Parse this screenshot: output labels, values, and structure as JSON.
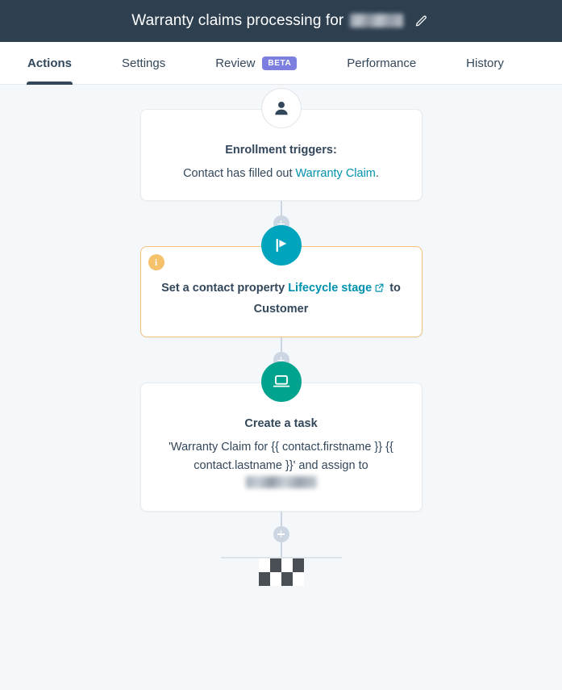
{
  "titlebar": {
    "title_prefix": "Warranty claims processing for",
    "redacted_company": "",
    "edit_icon": "pencil-icon"
  },
  "tabs": [
    {
      "label": "Actions",
      "active": true,
      "badge": null
    },
    {
      "label": "Settings",
      "active": false,
      "badge": null
    },
    {
      "label": "Review",
      "active": false,
      "badge": "BETA"
    },
    {
      "label": "Performance",
      "active": false,
      "badge": null
    },
    {
      "label": "History",
      "active": false,
      "badge": null
    }
  ],
  "flow": {
    "trigger": {
      "icon": "contact-person-icon",
      "title": "Enrollment triggers:",
      "text_before_link": "Contact has filled out ",
      "link": "Warranty Claim",
      "text_after_link": "."
    },
    "action_set_property": {
      "icon": "flag-icon",
      "badge_icon": "info-icon",
      "text_before_link": "Set a contact property ",
      "link": "Lifecycle stage",
      "external_link_icon": "external-link-icon",
      "text_after_link": " to Customer"
    },
    "action_create_task": {
      "icon": "laptop-task-icon",
      "title": "Create a task",
      "body_part_1": "'Warranty Claim for {{ contact.firstname }} {{ contact.lastname }}' and assign to ",
      "redacted_assignee": ""
    },
    "add_step_icon": "plus-icon",
    "end_icon": "checkered-flag-icon"
  },
  "colors": {
    "titlebar_bg": "#2e3f50",
    "page_bg": "#f5f8fa",
    "link_teal": "#0091ae",
    "teal_node": "#00a4bd",
    "green_node": "#00a38d",
    "warn_orange": "#f5c26b",
    "beta_purple": "#7c7fdf",
    "connector_gray": "#cbd6e2",
    "text_navy": "#33475b"
  }
}
